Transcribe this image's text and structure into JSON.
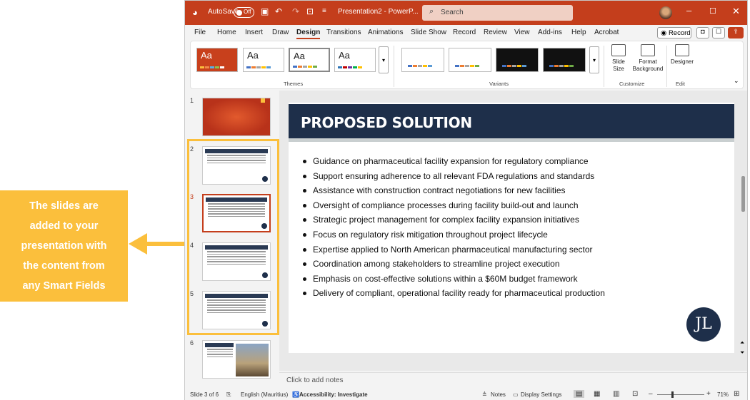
{
  "callout": {
    "lines": [
      "The slides are",
      "added to your",
      "presentation with",
      "the content from",
      "any Smart Fields"
    ],
    "bg": "#fbbf3c"
  },
  "titlebar": {
    "autosave": "AutoSave",
    "toggle": "Off",
    "doc": "Presentation2 - PowerP...",
    "search": "Search",
    "accent": "#c43e1c"
  },
  "menu": {
    "tabs": [
      "File",
      "Home",
      "Insert",
      "Draw",
      "Design",
      "Transitions",
      "Animations",
      "Slide Show",
      "Record",
      "Review",
      "View",
      "Add-ins",
      "Help",
      "Acrobat"
    ],
    "active": "Design",
    "record": "Record"
  },
  "ribbon": {
    "theme_label": "Aa",
    "groups": {
      "themes": "Themes",
      "variants": "Variants",
      "customize": "Customize",
      "edit": "Edit"
    },
    "slide_size": "Slide Size",
    "format_bg1": "Format",
    "format_bg2": "Background",
    "designer": "Designer"
  },
  "thumbnails": {
    "numbers": [
      "1",
      "2",
      "3",
      "4",
      "5",
      "6"
    ],
    "current": "3"
  },
  "slide": {
    "title": "PROPOSED SOLUTION",
    "bullets": [
      "Guidance on pharmaceutical facility expansion for regulatory compliance",
      "Support ensuring adherence to all relevant FDA regulations and standards",
      "Assistance with construction contract negotiations for new facilities",
      "Oversight of compliance processes during facility build-out and launch",
      "Strategic project management for complex facility expansion initiatives",
      "Focus on regulatory risk mitigation throughout project lifecycle",
      "Expertise applied to North American pharmaceutical manufacturing sector",
      "Coordination among stakeholders to streamline project execution",
      "Emphasis on cost-effective solutions within a $60M budget framework",
      "Delivery of compliant, operational facility ready for pharmaceutical production"
    ],
    "logo": "JL",
    "header_color": "#1e2f4a"
  },
  "notes": "Click to add notes",
  "status": {
    "slide": "Slide 3 of 6",
    "lang": "English (Mauritius)",
    "access": "Accessibility: Investigate",
    "notes": "Notes",
    "display": "Display Settings",
    "zoom": "71%"
  }
}
